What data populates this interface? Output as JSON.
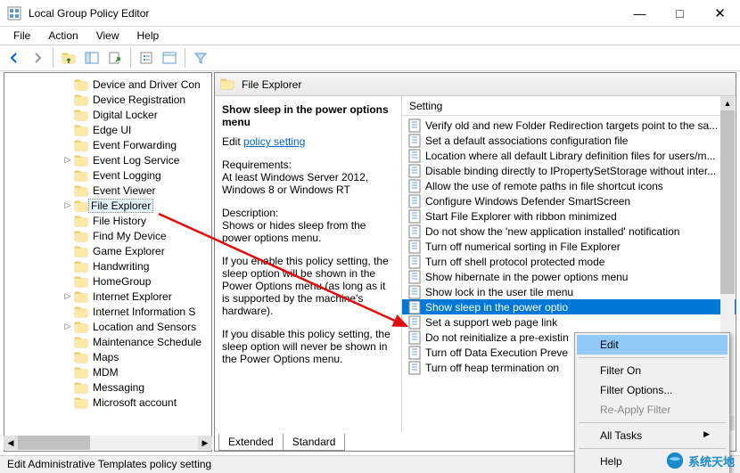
{
  "window": {
    "title": "Local Group Policy Editor"
  },
  "menubar": [
    "File",
    "Action",
    "View",
    "Help"
  ],
  "tree": {
    "indent": 76,
    "items": [
      {
        "label": "Device and Driver Con",
        "expander": ""
      },
      {
        "label": "Device Registration",
        "expander": ""
      },
      {
        "label": "Digital Locker",
        "expander": ""
      },
      {
        "label": "Edge UI",
        "expander": ""
      },
      {
        "label": "Event Forwarding",
        "expander": ""
      },
      {
        "label": "Event Log Service",
        "expander": "▷"
      },
      {
        "label": "Event Logging",
        "expander": ""
      },
      {
        "label": "Event Viewer",
        "expander": ""
      },
      {
        "label": "File Explorer",
        "expander": "▷",
        "selected": true
      },
      {
        "label": "File History",
        "expander": ""
      },
      {
        "label": "Find My Device",
        "expander": ""
      },
      {
        "label": "Game Explorer",
        "expander": ""
      },
      {
        "label": "Handwriting",
        "expander": ""
      },
      {
        "label": "HomeGroup",
        "expander": ""
      },
      {
        "label": "Internet Explorer",
        "expander": "▷"
      },
      {
        "label": "Internet Information S",
        "expander": ""
      },
      {
        "label": "Location and Sensors",
        "expander": "▷"
      },
      {
        "label": "Maintenance Schedule",
        "expander": ""
      },
      {
        "label": "Maps",
        "expander": ""
      },
      {
        "label": "MDM",
        "expander": ""
      },
      {
        "label": "Messaging",
        "expander": ""
      },
      {
        "label": "Microsoft account",
        "expander": ""
      }
    ]
  },
  "details": {
    "header_title": "File Explorer",
    "description": {
      "title": "Show sleep in the power options menu",
      "edit_prefix": "Edit ",
      "edit_link": "policy setting ",
      "requirements_label": "Requirements:",
      "requirements_text": "At least Windows Server 2012, Windows 8 or Windows RT",
      "description_label": "Description:",
      "description_text": "Shows or hides sleep from the power options menu.",
      "para2": "If you enable this policy setting, the sleep option will be shown in the Power Options menu (as long as it is supported by the machine's hardware).",
      "para3": "If you disable this policy setting, the sleep option will never be shown in the Power Options menu."
    },
    "list_header": "Setting",
    "settings": [
      "Verify old and new Folder Redirection targets point to the sa...",
      "Set a default associations configuration file",
      "Location where all default Library definition files for users/m...",
      "Disable binding directly to IPropertySetStorage without inter...",
      "Allow the use of remote paths in file shortcut icons",
      "Configure Windows Defender SmartScreen",
      "Start File Explorer with ribbon minimized",
      "Do not show the 'new application installed' notification",
      "Turn off numerical sorting in File Explorer",
      "Turn off shell protocol protected mode",
      "Show hibernate in the power options menu",
      "Show lock in the user tile menu",
      "Show sleep in the power optio",
      "Set a support web page link",
      "Do not reinitialize a pre-existin",
      "Turn off Data Execution Preve",
      "Turn off heap termination on"
    ],
    "selected_index": 12,
    "visible_cut_from": 12,
    "tabs": [
      "Extended",
      "Standard"
    ],
    "active_tab": 0
  },
  "context_menu": {
    "items": [
      {
        "label": "Edit",
        "hover": true
      },
      {
        "sep": true
      },
      {
        "label": "Filter On"
      },
      {
        "label": "Filter Options..."
      },
      {
        "label": "Re-Apply Filter",
        "disabled": true
      },
      {
        "sep": true
      },
      {
        "label": "All Tasks",
        "submenu": true
      },
      {
        "sep": true
      },
      {
        "label": "Help"
      }
    ]
  },
  "statusbar": "Edit Administrative Templates policy setting",
  "watermark": "系统天地"
}
